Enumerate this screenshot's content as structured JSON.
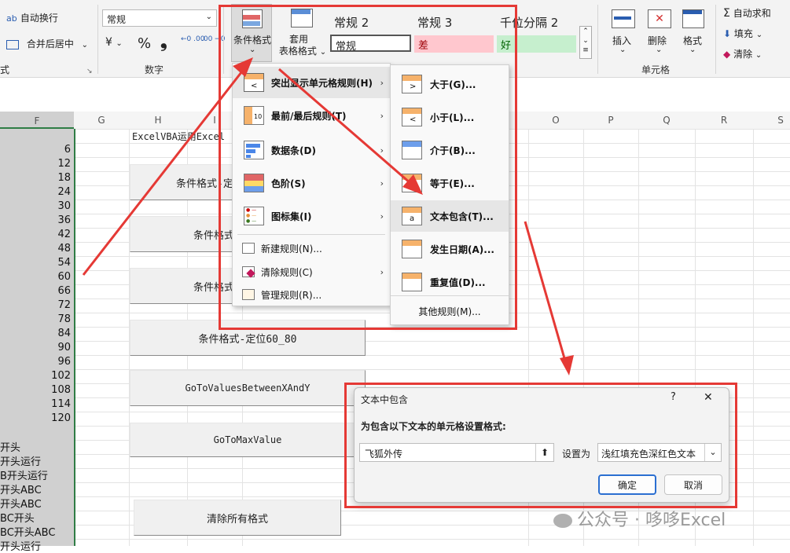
{
  "ribbon": {
    "wrap_text": "自动换行",
    "merge_center": "合并后居中",
    "number_format": "常规",
    "currency_symbol": "¥",
    "percent_symbol": "%",
    "comma_symbol": "❟",
    "dec_increase": "←0 .00",
    "dec_decrease": ".00 →0",
    "group_number": "数字",
    "cond_format": "条件格式",
    "table_format_line1": "套用",
    "table_format_line2": "表格格式",
    "styles": [
      {
        "label": "常规 2",
        "preview": "常规"
      },
      {
        "label": "常规 3",
        "preview": "差"
      },
      {
        "label": "千位分隔 2",
        "preview": "好"
      }
    ],
    "insert": "插入",
    "delete": "删除",
    "format": "格式",
    "group_cells": "单元格",
    "autosum": "自动求和",
    "fill": "填充",
    "clear": "清除",
    "left_edge_label": "式"
  },
  "columns": [
    "F",
    "G",
    "H",
    "I",
    "O",
    "P",
    "Q",
    "R",
    "S"
  ],
  "column_f_numbers": [
    "6",
    "12",
    "18",
    "24",
    "30",
    "36",
    "42",
    "48",
    "54",
    "60",
    "66",
    "72",
    "78",
    "84",
    "90",
    "96",
    "102",
    "108",
    "114",
    "120"
  ],
  "column_f_texts": [
    "开头",
    "开头运行",
    "B开头运行",
    "开头ABC",
    "开头ABC",
    "BC开头",
    "BC开头ABC",
    "开头运行"
  ],
  "sheet": {
    "h_title": "ExcelVBA运用Excel",
    "buttons": [
      "条件格式-定",
      "条件格式",
      "条件格式",
      "条件格式-定位60_80",
      "GoToValuesBetweenXAndY",
      "GoToMaxValue",
      "清除所有格式"
    ]
  },
  "cf_menu": {
    "items": [
      {
        "label": "突出显示单元格规则(H)"
      },
      {
        "label": "最前/最后规则(T)"
      },
      {
        "label": "数据条(D)"
      },
      {
        "label": "色阶(S)"
      },
      {
        "label": "图标集(I)"
      },
      {
        "label": "新建规则(N)..."
      },
      {
        "label": "清除规则(C)"
      },
      {
        "label": "管理规则(R)..."
      }
    ]
  },
  "submenu": {
    "items": [
      {
        "label": "大于(G)..."
      },
      {
        "label": "小于(L)..."
      },
      {
        "label": "介于(B)..."
      },
      {
        "label": "等于(E)..."
      },
      {
        "label": "文本包含(T)..."
      },
      {
        "label": "发生日期(A)..."
      },
      {
        "label": "重复值(D)..."
      }
    ],
    "more_rules": "其他规则(M)..."
  },
  "dialog": {
    "title": "文本中包含",
    "help": "?",
    "close": "✕",
    "prompt": "为包含以下文本的单元格设置格式:",
    "input_value": "飞狐外传",
    "set_as": "设置为",
    "format_option": "浅红填充色深红色文本",
    "ok": "确定",
    "cancel": "取消"
  },
  "watermark": "公众号 · 哆哆Excel",
  "colors": {
    "annotation_red": "#e53935",
    "bad_fill": "#ffc7ce",
    "good_fill": "#c6efce",
    "selection_green": "#2f7d46",
    "ok_border": "#2b6fd1"
  }
}
